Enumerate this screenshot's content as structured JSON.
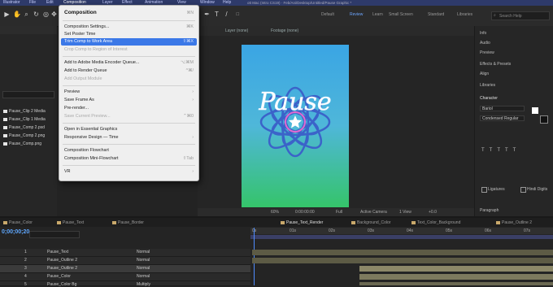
{
  "menubar": {
    "items": [
      "Illustrator",
      "File",
      "Edit",
      "Composition",
      "Layer",
      "Effect",
      "Animation",
      "View",
      "Window",
      "Help"
    ]
  },
  "window": {
    "title": "ott Mac (Intro CS19) · Feb/Ani/Desktop/Untitled/Pause Graphic *"
  },
  "toolbar": {
    "items": [
      "Default",
      "Review",
      "Learn",
      "Small Screen",
      "Standard",
      "Libraries"
    ],
    "search_placeholder": "Search Help"
  },
  "menu": {
    "title": "Composition",
    "items": [
      {
        "label": "Composition Settings...",
        "shortcut": "⌘K",
        "disabled": false
      },
      {
        "label": "Set Poster Time",
        "shortcut": "",
        "disabled": false
      },
      {
        "label": "Trim Comp to Work Area",
        "shortcut": "⇧⌘X",
        "disabled": false,
        "highlighted": true
      },
      {
        "label": "Crop Comp to Region of Interest",
        "shortcut": "",
        "disabled": true
      },
      {
        "label": "Add to Adobe Media Encoder Queue...",
        "shortcut": "⌥⌘M",
        "disabled": false
      },
      {
        "label": "Add to Render Queue",
        "shortcut": "^⌘/",
        "disabled": false
      },
      {
        "label": "Add Output Module",
        "shortcut": "",
        "disabled": true
      },
      {
        "label": "Preview",
        "shortcut": "›",
        "disabled": false
      },
      {
        "label": "Save Frame As",
        "shortcut": "›",
        "disabled": false
      },
      {
        "label": "Pre-render...",
        "shortcut": "",
        "disabled": false
      },
      {
        "label": "Save Current Preview...",
        "shortcut": "⌃⌘0",
        "disabled": true
      },
      {
        "label": "Open in Essential Graphics",
        "shortcut": "",
        "disabled": false
      },
      {
        "label": "Responsive Design — Time",
        "shortcut": "›",
        "disabled": false
      },
      {
        "label": "Composition Flowchart",
        "shortcut": "",
        "disabled": false
      },
      {
        "label": "Composition Mini-Flowchart",
        "shortcut": "⇧Tab",
        "disabled": false
      },
      {
        "label": "VR",
        "shortcut": "›",
        "disabled": false
      }
    ]
  },
  "project": {
    "items": [
      "Pause_Clip 2 Media",
      "Pause_Clip 1 Media",
      "Pause_Comp 2.psd",
      "Pause_Comp 2.png",
      "Pause_Comp.png"
    ]
  },
  "composition": {
    "tabs": [
      "Layer (none)",
      "Footage (none)"
    ],
    "artwork_text": "Pause",
    "footer": [
      "60%",
      "0:00:00:00",
      "Full",
      "Active Camera",
      "1 View",
      "+0.0"
    ],
    "colors": {
      "green": "#35c46a",
      "blue": "#4f98e0",
      "flower": "#3b63c9",
      "star": "#ffffff",
      "ring": "#e06ad0"
    }
  },
  "right_panel": {
    "items": [
      "Info",
      "Audio",
      "Preview",
      "Effects & Presets",
      "Align",
      "Libraries",
      "Character",
      "Paragraph"
    ],
    "font": "Bariol",
    "font_style": "Condensed Regular",
    "checks": [
      "Ligatures",
      "Hindi Digits"
    ]
  },
  "timeline": {
    "tabs": [
      "Pause_Color",
      "Pause_Text",
      "Pause_Border",
      "Pause_Text_Render",
      "Background_Color",
      "Text_Color_Background",
      "Pause_Outline 2"
    ],
    "timecode": "0;00;00;20",
    "layers": [
      {
        "num": "1",
        "name": "Pause_Text",
        "mode": "Normal"
      },
      {
        "num": "2",
        "name": "Pause_Outline 2",
        "mode": "Normal"
      },
      {
        "num": "3",
        "name": "Pause_Outline 2",
        "mode": "Normal"
      },
      {
        "num": "4",
        "name": "Pause_Color",
        "mode": "Normal"
      },
      {
        "num": "5",
        "name": "Pause_Color Bg",
        "mode": "Multiply"
      }
    ],
    "ruler": [
      "0s",
      "01s",
      "02s",
      "03s",
      "04s",
      "05s",
      "06s",
      "07s"
    ]
  }
}
